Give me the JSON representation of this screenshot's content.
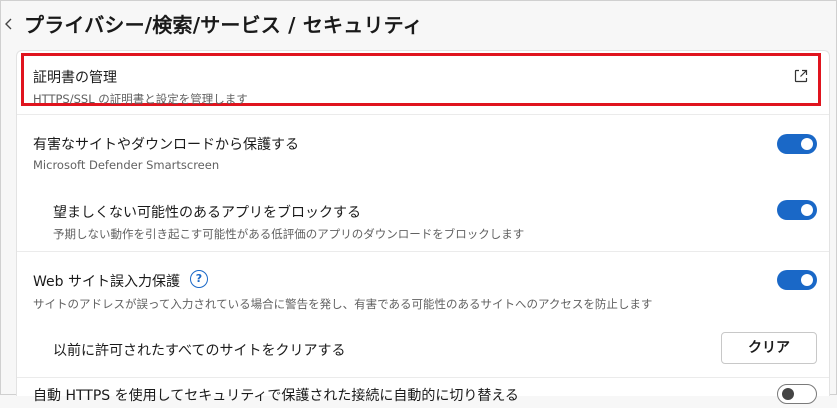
{
  "header": {
    "title": "プライバシー/検索/サービス / セキュリティ"
  },
  "certificates": {
    "title": "証明書の管理",
    "description": "HTTPS/SSL の証明書と設定を管理します"
  },
  "smartscreen": {
    "title": "有害なサイトやダウンロードから保護する",
    "description": "Microsoft Defender Smartscreen",
    "enabled": true
  },
  "pua_block": {
    "title": "望ましくない可能性のあるアプリをブロックする",
    "description": "予期しない動作を引き起こす可能性がある低評価のアプリのダウンロードをブロックします",
    "enabled": true
  },
  "typo_protection": {
    "title": "Web サイト誤入力保護",
    "help_glyph": "?",
    "description": "サイトのアドレスが誤って入力されている場合に警告を発し、有害である可能性のあるサイトへのアクセスを防止します",
    "enabled": true
  },
  "clear_allowed": {
    "title": "以前に許可されたすべてのサイトをクリアする",
    "button_label": "クリア"
  },
  "auto_https": {
    "title": "自動 HTTPS を使用してセキュリティで保護された接続に自動的に切り替える",
    "enabled": false
  },
  "colors": {
    "accent": "#1a68c7",
    "highlight": "#e0141e"
  },
  "icons": {
    "back": "chevron-left-icon",
    "external": "external-link-icon",
    "help": "help-circle-icon"
  }
}
